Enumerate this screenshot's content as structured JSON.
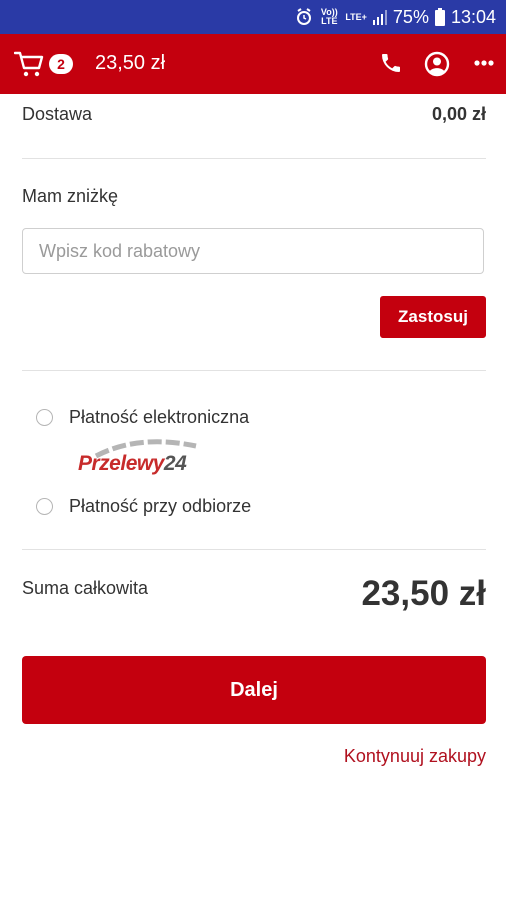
{
  "status_bar": {
    "battery": "75%",
    "time": "13:04",
    "volte": "Vo)) LTE",
    "lte": "LTE+"
  },
  "app_bar": {
    "cart_count": "2",
    "cart_total": "23,50 zł"
  },
  "summary": {
    "delivery_label": "Dostawa",
    "delivery_value": "0,00 zł"
  },
  "discount": {
    "label": "Mam zniżkę",
    "placeholder": "Wpisz kod rabatowy",
    "apply_label": "Zastosuj"
  },
  "payment": {
    "options": [
      {
        "label": "Płatność elektroniczna"
      },
      {
        "label": "Płatność przy odbiorze"
      }
    ],
    "provider_logo_text_1": "Przelewy",
    "provider_logo_text_2": "24"
  },
  "total": {
    "label": "Suma całkowita",
    "value": "23,50 zł"
  },
  "actions": {
    "next_label": "Dalej",
    "continue_label": "Kontynuuj zakupy"
  },
  "colors": {
    "brand": "#c4000e",
    "status_bar": "#2a3aa6"
  },
  "icons": [
    "alarm-icon",
    "signal-icon",
    "battery-icon",
    "cart-icon",
    "phone-icon",
    "user-icon",
    "more-icon"
  ]
}
